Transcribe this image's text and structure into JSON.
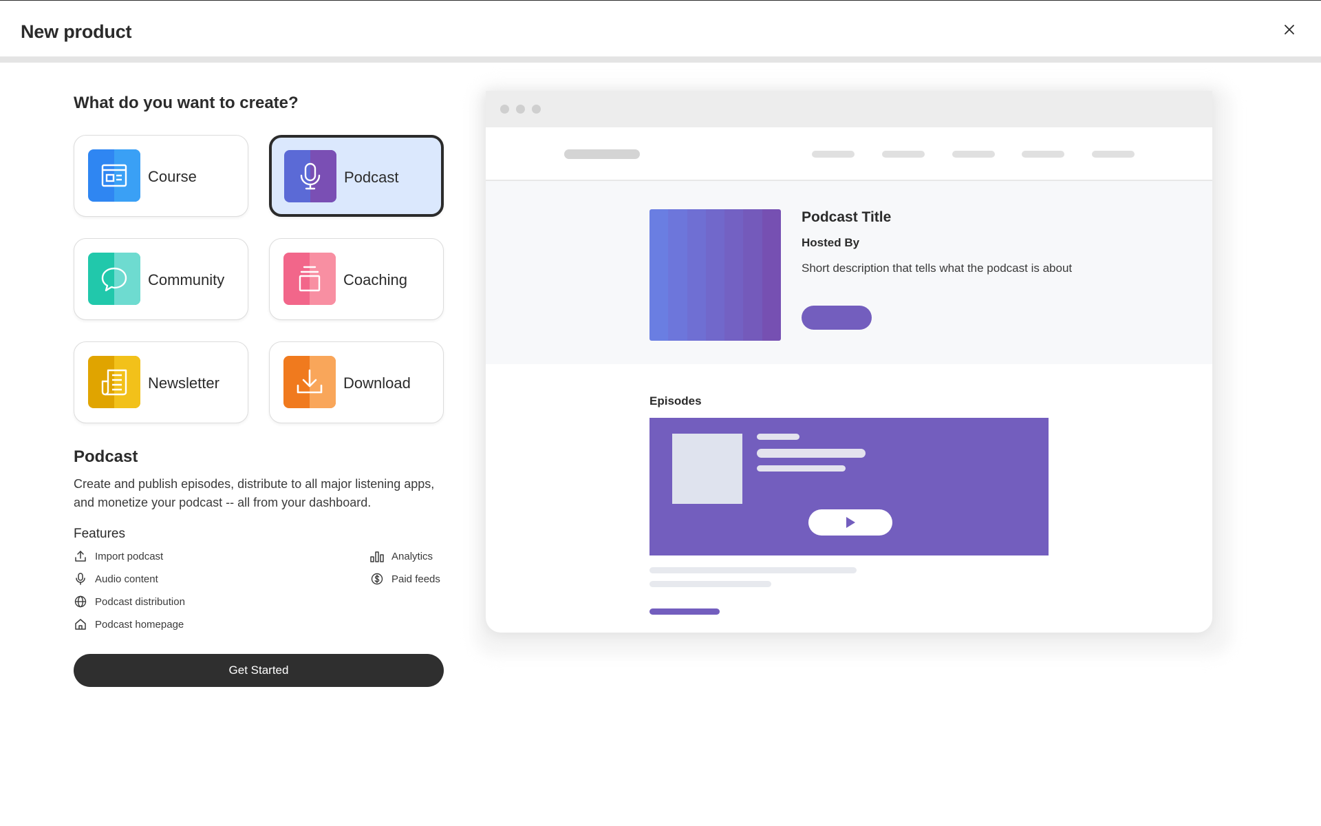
{
  "header": {
    "title": "New product"
  },
  "heading": "What do you want to create?",
  "product_types": [
    {
      "label": "Course",
      "icon": "course-icon",
      "selected": false,
      "colors": [
        "#2f86f2",
        "#3aa0f5"
      ]
    },
    {
      "label": "Podcast",
      "icon": "microphone-icon",
      "selected": true,
      "colors": [
        "#5b6ad6",
        "#7a4fb4"
      ]
    },
    {
      "label": "Community",
      "icon": "chat-bubble-icon",
      "selected": false,
      "colors": [
        "#21c8ab",
        "#6edbd0"
      ]
    },
    {
      "label": "Coaching",
      "icon": "coaching-icon",
      "selected": false,
      "colors": [
        "#f2668a",
        "#f88fa2"
      ]
    },
    {
      "label": "Newsletter",
      "icon": "newsletter-icon",
      "selected": false,
      "colors": [
        "#e0a400",
        "#f2c11a"
      ]
    },
    {
      "label": "Download",
      "icon": "download-icon",
      "selected": false,
      "colors": [
        "#f07a1e",
        "#f9a65a"
      ]
    }
  ],
  "details": {
    "title": "Podcast",
    "description": "Create and publish episodes, distribute to all major listening apps, and monetize your podcast -- all from your dashboard.",
    "features_title": "Features",
    "features": [
      {
        "label": "Import podcast",
        "icon": "upload-icon"
      },
      {
        "label": "Audio content",
        "icon": "microphone-icon"
      },
      {
        "label": "Podcast distribution",
        "icon": "globe-icon"
      },
      {
        "label": "Podcast homepage",
        "icon": "home-icon"
      },
      {
        "label": "Analytics",
        "icon": "bar-chart-icon"
      },
      {
        "label": "Paid feeds",
        "icon": "dollar-circle-icon"
      }
    ],
    "cta": "Get Started"
  },
  "preview": {
    "podcast_title": "Podcast Title",
    "hosted_by": "Hosted By",
    "description": "Short description that tells what the podcast is about",
    "episodes_title": "Episodes",
    "accent": "#735ebe"
  }
}
